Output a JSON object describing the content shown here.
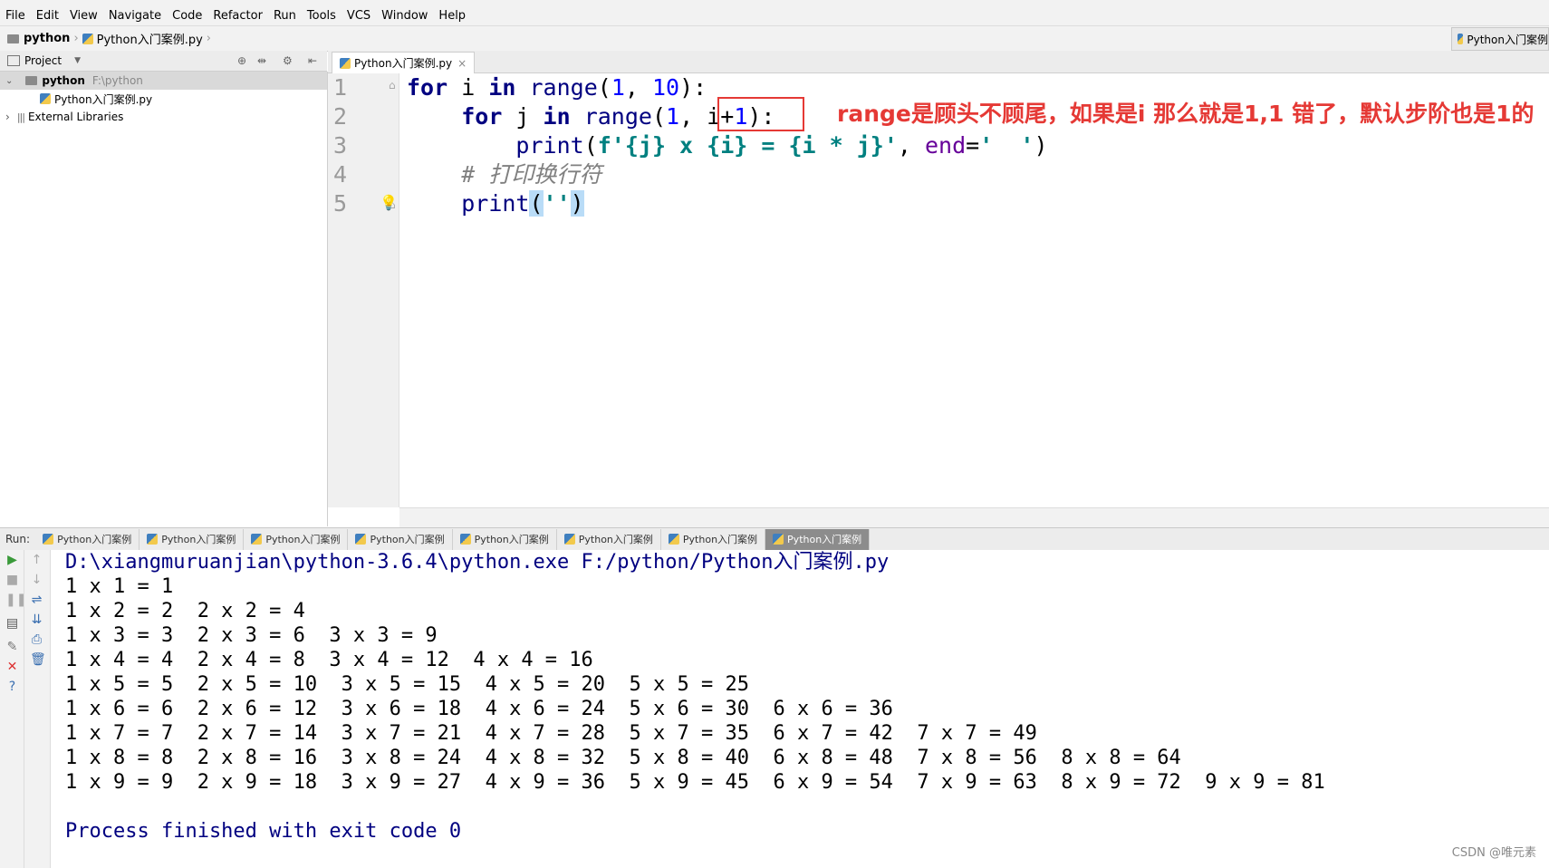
{
  "menu": [
    "File",
    "Edit",
    "View",
    "Navigate",
    "Code",
    "Refactor",
    "Run",
    "Tools",
    "VCS",
    "Window",
    "Help"
  ],
  "nav": {
    "project": "python",
    "file": "Python入门案例.py",
    "right_tab": "Python入门案例"
  },
  "project_panel": {
    "title": "Project",
    "items": [
      {
        "label": "python",
        "path": "F:\\python"
      },
      {
        "label": "Python入门案例.py"
      },
      {
        "label": "External Libraries"
      }
    ]
  },
  "editor": {
    "tab": "Python入门案例.py",
    "line_numbers": [
      "1",
      "2",
      "3",
      "4",
      "5"
    ]
  },
  "annotation": "range是顾头不顾尾，如果是i  那么就是1,1  错了，默认步阶也是1的",
  "run": {
    "label": "Run:",
    "tabs": [
      "Python入门案例",
      "Python入门案例",
      "Python入门案例",
      "Python入门案例",
      "Python入门案例",
      "Python入门案例",
      "Python入门案例",
      "Python入门案例"
    ],
    "console": [
      "D:\\xiangmuruanjian\\python-3.6.4\\python.exe F:/python/Python入门案例.py",
      "1 x 1 = 1",
      "1 x 2 = 2  2 x 2 = 4",
      "1 x 3 = 3  2 x 3 = 6  3 x 3 = 9",
      "1 x 4 = 4  2 x 4 = 8  3 x 4 = 12  4 x 4 = 16",
      "1 x 5 = 5  2 x 5 = 10  3 x 5 = 15  4 x 5 = 20  5 x 5 = 25",
      "1 x 6 = 6  2 x 6 = 12  3 x 6 = 18  4 x 6 = 24  5 x 6 = 30  6 x 6 = 36",
      "1 x 7 = 7  2 x 7 = 14  3 x 7 = 21  4 x 7 = 28  5 x 7 = 35  6 x 7 = 42  7 x 7 = 49",
      "1 x 8 = 8  2 x 8 = 16  3 x 8 = 24  4 x 8 = 32  5 x 8 = 40  6 x 8 = 48  7 x 8 = 56  8 x 8 = 64",
      "1 x 9 = 9  2 x 9 = 18  3 x 9 = 27  4 x 9 = 36  5 x 9 = 45  6 x 9 = 54  7 x 9 = 63  8 x 9 = 72  9 x 9 = 81",
      "",
      "Process finished with exit code 0"
    ]
  },
  "watermark": "CSDN @唯元素"
}
